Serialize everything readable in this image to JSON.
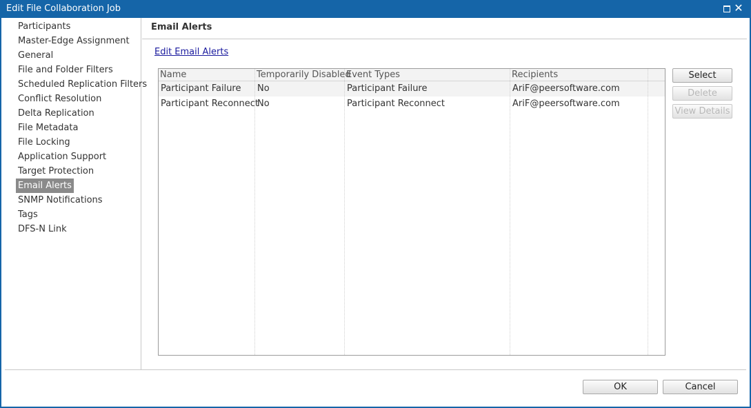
{
  "window": {
    "title": "Edit File Collaboration Job"
  },
  "nav": {
    "items": [
      {
        "label": "Participants",
        "selected": false
      },
      {
        "label": "Master-Edge Assignment",
        "selected": false
      },
      {
        "label": "General",
        "selected": false
      },
      {
        "label": "File and Folder Filters",
        "selected": false
      },
      {
        "label": "Scheduled Replication Filters",
        "selected": false
      },
      {
        "label": "Conflict Resolution",
        "selected": false
      },
      {
        "label": "Delta Replication",
        "selected": false
      },
      {
        "label": "File Metadata",
        "selected": false
      },
      {
        "label": "File Locking",
        "selected": false
      },
      {
        "label": "Application Support",
        "selected": false
      },
      {
        "label": "Target Protection",
        "selected": false
      },
      {
        "label": "Email Alerts",
        "selected": true
      },
      {
        "label": "SNMP Notifications",
        "selected": false
      },
      {
        "label": "Tags",
        "selected": false
      },
      {
        "label": "DFS-N Link",
        "selected": false
      }
    ]
  },
  "pane": {
    "title": "Email Alerts",
    "edit_link": "Edit Email Alerts"
  },
  "table": {
    "columns": [
      "Name",
      "Temporarily Disabled",
      "Event Types",
      "Recipients"
    ],
    "rows": [
      [
        "Participant Failure",
        "No",
        "Participant Failure",
        "AriF@peersoftware.com"
      ],
      [
        "Participant Reconnect",
        "No",
        "Participant Reconnect",
        "AriF@peersoftware.com"
      ]
    ]
  },
  "actions": {
    "select": "Select",
    "delete": "Delete",
    "view_details": "View Details"
  },
  "footer": {
    "ok": "OK",
    "cancel": "Cancel"
  },
  "colors": {
    "titlebar": "#1565a8",
    "selected_nav": "#8a8a8a",
    "link": "#1a1a9e"
  }
}
